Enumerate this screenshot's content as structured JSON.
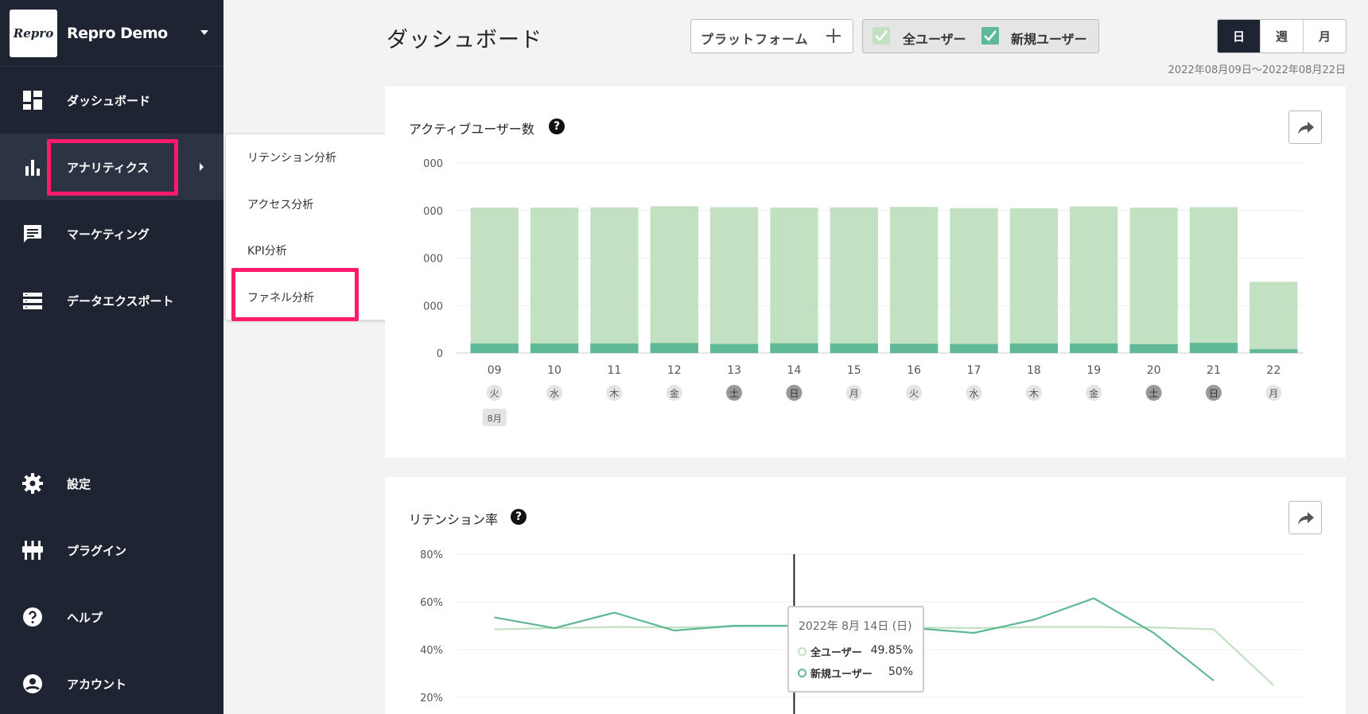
{
  "app": {
    "logo_text": "Repro",
    "name": "Repro Demo"
  },
  "nav": [
    {
      "label": "ダッシュボード",
      "icon": "dashboard-icon"
    },
    {
      "label": "アナリティクス",
      "icon": "bar-chart-icon"
    },
    {
      "label": "マーケティング",
      "icon": "chat-icon"
    },
    {
      "label": "データエクスポート",
      "icon": "list-icon"
    },
    {
      "label": "設定",
      "icon": "gear-icon"
    },
    {
      "label": "プラグイン",
      "icon": "plugin-icon"
    },
    {
      "label": "ヘルプ",
      "icon": "help-icon"
    },
    {
      "label": "アカウント",
      "icon": "account-icon"
    }
  ],
  "submenu": [
    "リテンション分析",
    "アクセス分析",
    "KPI分析",
    "ファネル分析"
  ],
  "header": {
    "title": "ダッシュボード",
    "platform_label": "プラットフォーム",
    "all_users_label": "全ユーザー",
    "new_users_label": "新規ユーザー",
    "granularity": [
      "日",
      "週",
      "月"
    ],
    "granularity_selected": "日",
    "date_range": "2022年08月09日〜2022年08月22日"
  },
  "colors": {
    "accent": "#ff1a6c",
    "sidebar": "#1e2431",
    "all_users": "#c2e1c2",
    "new_users": "#5fb896"
  },
  "active_users_card": {
    "title": "アクティブユーザー数"
  },
  "retention_card": {
    "title": "リテンション率"
  },
  "chart_data": [
    {
      "type": "bar",
      "title": "アクティブユーザー数",
      "yticks": [
        "0",
        "000",
        "000",
        "000",
        "000"
      ],
      "categories": [
        "09",
        "10",
        "11",
        "12",
        "13",
        "14",
        "15",
        "16",
        "17",
        "18",
        "19",
        "20",
        "21",
        "22"
      ],
      "weekdays": [
        "火",
        "水",
        "木",
        "金",
        "土",
        "日",
        "月",
        "火",
        "水",
        "木",
        "金",
        "土",
        "日",
        "月"
      ],
      "month_label": "8月",
      "ylim": [
        0,
        4000
      ],
      "series": [
        {
          "name": "全ユーザー",
          "values": [
            3060,
            3060,
            3065,
            3090,
            3070,
            3060,
            3065,
            3075,
            3050,
            3045,
            3085,
            3060,
            3070,
            1500
          ]
        },
        {
          "name": "新規ユーザー",
          "values": [
            200,
            200,
            200,
            210,
            190,
            205,
            200,
            195,
            190,
            200,
            200,
            185,
            215,
            80
          ]
        }
      ]
    },
    {
      "type": "line",
      "title": "リテンション率",
      "yticks": [
        "80%",
        "60%",
        "40%",
        "20%"
      ],
      "ylim": [
        20,
        80
      ],
      "series": [
        {
          "name": "全ユーザー",
          "values": [
            48.5,
            49,
            49.5,
            49.3,
            49.7,
            49.85,
            49.5,
            49.3,
            49,
            49.5,
            49.5,
            49.3,
            48.5,
            25
          ]
        },
        {
          "name": "新規ユーザー",
          "values": [
            53.5,
            49,
            55.5,
            48,
            50,
            50,
            49.5,
            49,
            47,
            52.5,
            61.5,
            47,
            27
          ]
        }
      ],
      "tooltip": {
        "date": "2022年 8月 14日 (日)",
        "rows": [
          {
            "label": "全ユーザー",
            "value": "49.85%"
          },
          {
            "label": "新規ユーザー",
            "value": "50%"
          }
        ]
      }
    }
  ]
}
